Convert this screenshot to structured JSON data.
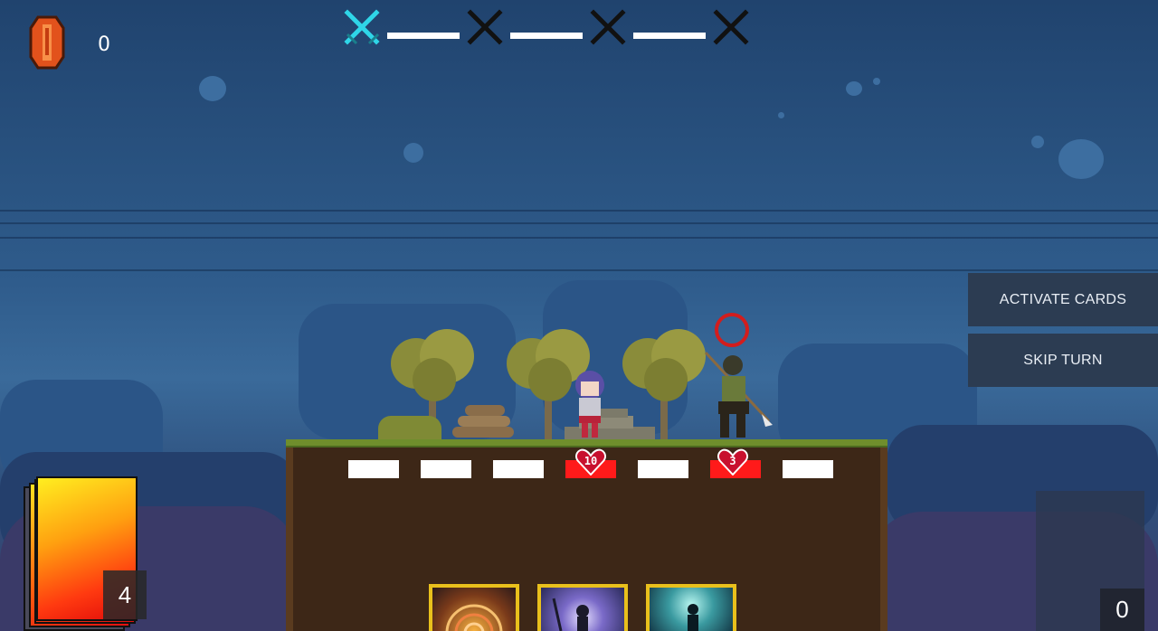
{
  "hud": {
    "gem_count": "0",
    "gem_icon": "gem-icon",
    "stages": [
      {
        "icon": "crossed-swords-icon",
        "state": "current",
        "color": "#2fd6e8"
      },
      {
        "icon": "crossed-swords-icon",
        "state": "locked",
        "color": "#111111"
      },
      {
        "icon": "crossed-swords-icon",
        "state": "locked",
        "color": "#111111"
      },
      {
        "icon": "crossed-swords-icon",
        "state": "locked",
        "color": "#111111"
      }
    ]
  },
  "actions": {
    "activate_label": "ACTIVATE CARDS",
    "skip_label": "SKIP TURN"
  },
  "board": {
    "slots": [
      {
        "state": "empty"
      },
      {
        "state": "empty"
      },
      {
        "state": "empty"
      },
      {
        "state": "player",
        "hp": "10"
      },
      {
        "state": "empty"
      },
      {
        "state": "enemy",
        "hp": "3"
      },
      {
        "state": "empty"
      }
    ]
  },
  "deck": {
    "count": "4"
  },
  "discard": {
    "count": "0"
  },
  "colors": {
    "slot_empty": "#ffffff",
    "slot_occupied": "#ff1a1a",
    "card_border": "#e9c01c",
    "button_bg": "#2c3c52"
  }
}
